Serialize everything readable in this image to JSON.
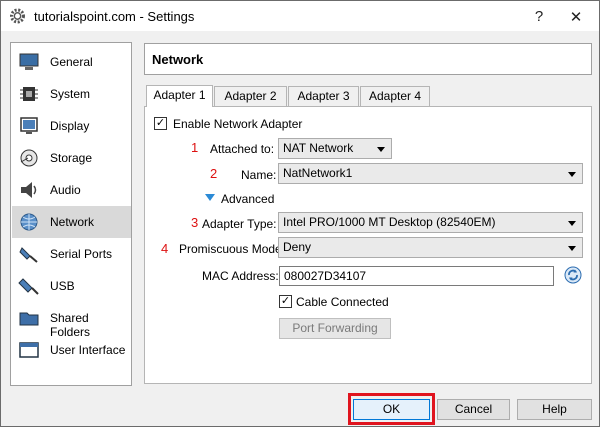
{
  "window": {
    "title": "tutorialspoint.com - Settings",
    "help": "?",
    "close": "✕"
  },
  "sidebar": {
    "items": [
      {
        "label": "General",
        "icon": "monitor-icon"
      },
      {
        "label": "System",
        "icon": "chip-icon"
      },
      {
        "label": "Display",
        "icon": "display-icon"
      },
      {
        "label": "Storage",
        "icon": "storage-icon"
      },
      {
        "label": "Audio",
        "icon": "speaker-icon"
      },
      {
        "label": "Network",
        "icon": "network-icon",
        "selected": true
      },
      {
        "label": "Serial Ports",
        "icon": "serial-port-icon"
      },
      {
        "label": "USB",
        "icon": "usb-icon"
      },
      {
        "label": "Shared Folders",
        "icon": "folder-icon"
      },
      {
        "label": "User Interface",
        "icon": "window-icon"
      }
    ]
  },
  "header": {
    "title": "Network"
  },
  "tabs": [
    "Adapter 1",
    "Adapter 2",
    "Adapter 3",
    "Adapter 4"
  ],
  "adapter": {
    "enable_label": "Enable Network Adapter",
    "enable_checked": "✓",
    "attached_num": "1",
    "attached_label": "Attached to:",
    "attached_value": "NAT Network",
    "name_num": "2",
    "name_label": "Name:",
    "name_value": "NatNetwork1",
    "advanced_label": "Advanced",
    "type_num": "3",
    "type_label": "Adapter Type:",
    "type_value": "Intel PRO/1000 MT Desktop (82540EM)",
    "promisc_num": "4",
    "promisc_label": "Promiscuous Mode:",
    "promisc_value": "Deny",
    "mac_label": "MAC Address:",
    "mac_value": "080027D34107",
    "cable_label": "Cable Connected",
    "cable_checked": "✓",
    "port_forwarding": "Port Forwarding"
  },
  "footer": {
    "ok": "OK",
    "cancel": "Cancel",
    "help": "Help"
  }
}
